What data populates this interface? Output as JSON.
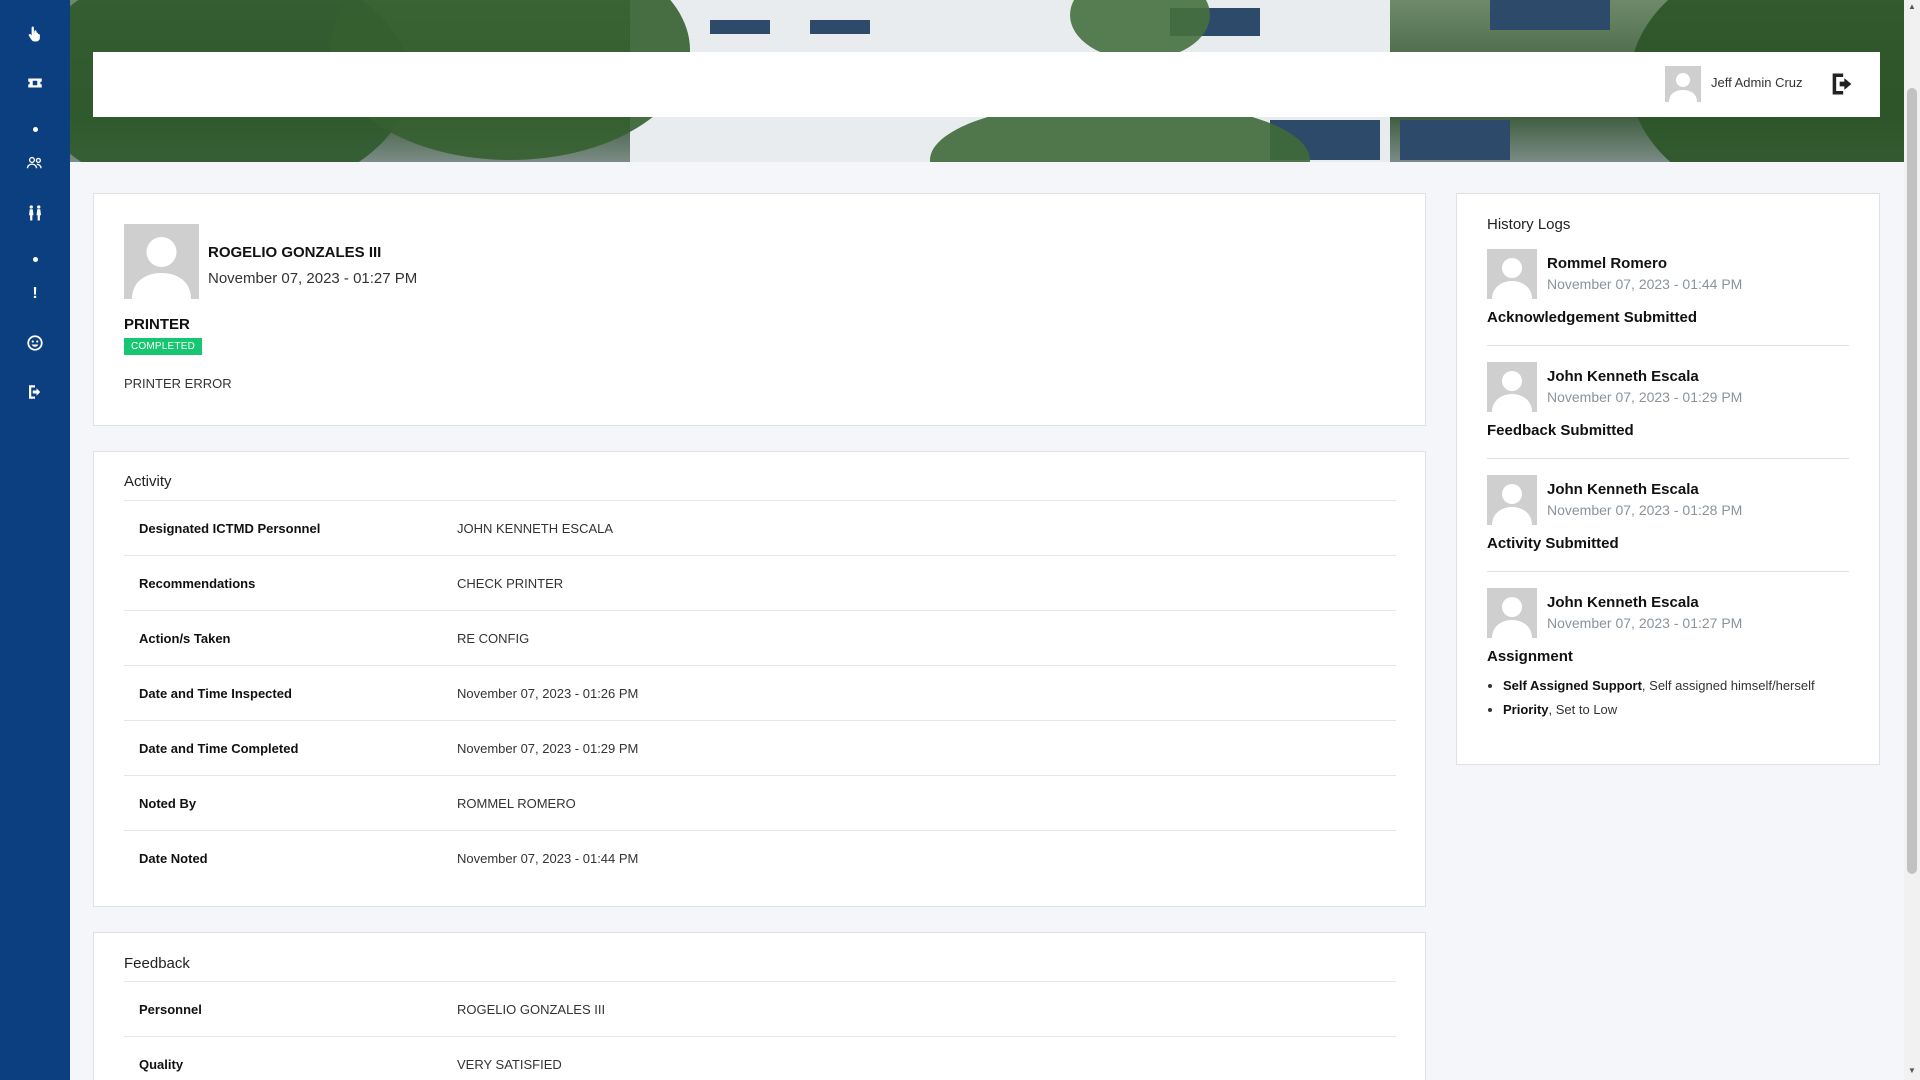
{
  "sidebar": {
    "icons": [
      "hand-pointer-icon",
      "ticket-icon",
      "dot-icon",
      "users-icon",
      "restroom-icon",
      "dot-icon",
      "exclamation-icon",
      "smile-icon",
      "logout-icon"
    ]
  },
  "topbar": {
    "user_name": "Jeff Admin Cruz"
  },
  "request": {
    "requester": "ROGELIO GONZALES III",
    "date": "November 07, 2023 - 01:27 PM",
    "category": "PRINTER",
    "status": "COMPLETED",
    "description": "PRINTER ERROR"
  },
  "activity": {
    "title": "Activity",
    "rows": [
      {
        "label": "Designated ICTMD Personnel",
        "value": "JOHN KENNETH ESCALA"
      },
      {
        "label": "Recommendations",
        "value": "CHECK PRINTER"
      },
      {
        "label": "Action/s Taken",
        "value": "RE CONFIG"
      },
      {
        "label": "Date and Time Inspected",
        "value": "November 07, 2023 - 01:26 PM"
      },
      {
        "label": "Date and Time Completed",
        "value": "November 07, 2023 - 01:29 PM"
      },
      {
        "label": "Noted By",
        "value": "ROMMEL ROMERO"
      },
      {
        "label": "Date Noted",
        "value": "November 07, 2023 - 01:44 PM"
      }
    ]
  },
  "feedback": {
    "title": "Feedback",
    "rows": [
      {
        "label": "Personnel",
        "value": "ROGELIO GONZALES III"
      },
      {
        "label": "Quality",
        "value": "VERY SATISFIED"
      }
    ]
  },
  "history": {
    "title": "History Logs",
    "items": [
      {
        "name": "Rommel Romero",
        "date": "November 07, 2023 - 01:44 PM",
        "action": "Acknowledgement Submitted"
      },
      {
        "name": "John Kenneth Escala",
        "date": "November 07, 2023 - 01:29 PM",
        "action": "Feedback Submitted"
      },
      {
        "name": "John Kenneth Escala",
        "date": "November 07, 2023 - 01:28 PM",
        "action": "Activity Submitted"
      },
      {
        "name": "John Kenneth Escala",
        "date": "November 07, 2023 - 01:27 PM",
        "action": "Assignment",
        "details": [
          {
            "key": "Self Assigned Support",
            "text": ", Self assigned himself/herself"
          },
          {
            "key": "Priority",
            "text": ", Set to Low"
          }
        ]
      }
    ]
  },
  "colors": {
    "sidebar": "#0c3f7f",
    "badge_completed": "#17c671"
  }
}
